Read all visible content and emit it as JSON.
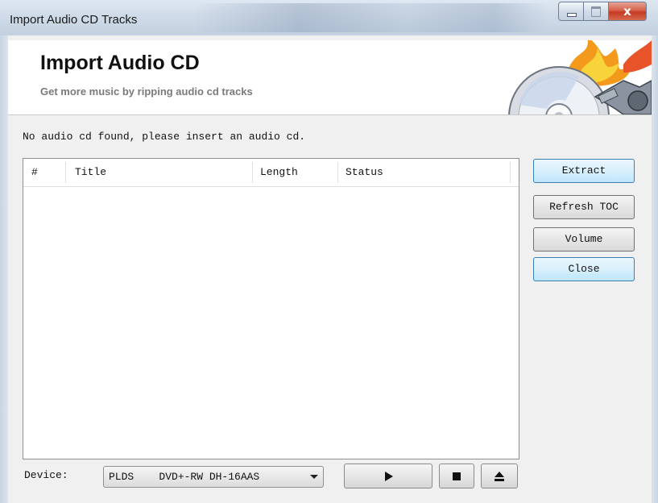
{
  "window": {
    "title": "Import Audio CD Tracks",
    "close_glyph": "x",
    "minimize_icon": "minimize-icon",
    "maximize_icon": "maximize-icon",
    "close_icon": "close-icon"
  },
  "banner": {
    "title": "Import Audio CD",
    "subtitle": "Get more music by ripping audio cd tracks",
    "art_icon": "cd-burn-icon"
  },
  "status_message": "No audio cd found, please insert an audio cd.",
  "track_list": {
    "columns": [
      "#",
      "Title",
      "Length",
      "Status"
    ],
    "rows": []
  },
  "buttons": {
    "extract": "Extract",
    "refresh_toc": "Refresh TOC",
    "volume": "Volume",
    "close": "Close"
  },
  "device": {
    "label": "Device:",
    "selected": "PLDS    DVD+-RW DH-16AAS"
  },
  "transport": {
    "play_icon": "play-icon",
    "stop_icon": "stop-icon",
    "eject_icon": "eject-icon"
  },
  "colors": {
    "hot_button_border": "#3c7fb1",
    "hot_button_fill": "#d9f0fc",
    "close_button": "#c53a22"
  }
}
